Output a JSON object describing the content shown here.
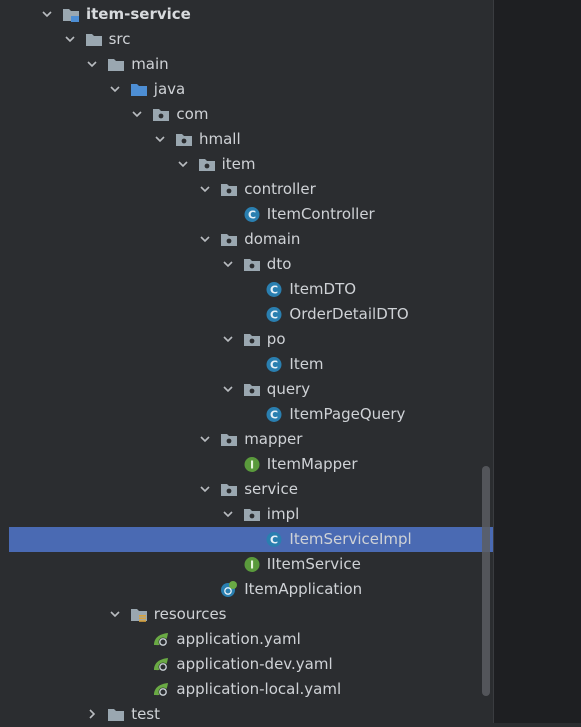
{
  "tree": {
    "nodes": [
      {
        "label": "item-service",
        "depth": 0,
        "icon": "module-folder-icon",
        "chevron": "down",
        "bold": true
      },
      {
        "label": "src",
        "depth": 1,
        "icon": "folder-icon",
        "chevron": "down"
      },
      {
        "label": "main",
        "depth": 2,
        "icon": "folder-icon",
        "chevron": "down"
      },
      {
        "label": "java",
        "depth": 3,
        "icon": "source-folder-icon",
        "chevron": "down"
      },
      {
        "label": "com",
        "depth": 4,
        "icon": "package-icon",
        "chevron": "down"
      },
      {
        "label": "hmall",
        "depth": 5,
        "icon": "package-icon",
        "chevron": "down"
      },
      {
        "label": "item",
        "depth": 6,
        "icon": "package-icon",
        "chevron": "down"
      },
      {
        "label": "controller",
        "depth": 7,
        "icon": "package-icon",
        "chevron": "down"
      },
      {
        "label": "ItemController",
        "depth": 8,
        "icon": "class-icon",
        "chevron": "none"
      },
      {
        "label": "domain",
        "depth": 7,
        "icon": "package-icon",
        "chevron": "down"
      },
      {
        "label": "dto",
        "depth": 8,
        "icon": "package-icon",
        "chevron": "down"
      },
      {
        "label": "ItemDTO",
        "depth": 9,
        "icon": "class-icon",
        "chevron": "none"
      },
      {
        "label": "OrderDetailDTO",
        "depth": 9,
        "icon": "class-icon",
        "chevron": "none"
      },
      {
        "label": "po",
        "depth": 8,
        "icon": "package-icon",
        "chevron": "down"
      },
      {
        "label": "Item",
        "depth": 9,
        "icon": "class-icon",
        "chevron": "none"
      },
      {
        "label": "query",
        "depth": 8,
        "icon": "package-icon",
        "chevron": "down"
      },
      {
        "label": "ItemPageQuery",
        "depth": 9,
        "icon": "class-icon",
        "chevron": "none"
      },
      {
        "label": "mapper",
        "depth": 7,
        "icon": "package-icon",
        "chevron": "down"
      },
      {
        "label": "ItemMapper",
        "depth": 8,
        "icon": "interface-icon",
        "chevron": "none"
      },
      {
        "label": "service",
        "depth": 7,
        "icon": "package-icon",
        "chevron": "down"
      },
      {
        "label": "impl",
        "depth": 8,
        "icon": "package-icon",
        "chevron": "down"
      },
      {
        "label": "ItemServiceImpl",
        "depth": 9,
        "icon": "class-icon",
        "chevron": "none",
        "selected": true
      },
      {
        "label": "IItemService",
        "depth": 8,
        "icon": "interface-icon",
        "chevron": "none"
      },
      {
        "label": "ItemApplication",
        "depth": 7,
        "icon": "spring-app-icon",
        "chevron": "none"
      },
      {
        "label": "resources",
        "depth": 3,
        "icon": "resources-folder-icon",
        "chevron": "down"
      },
      {
        "label": "application.yaml",
        "depth": 4,
        "icon": "spring-config-icon",
        "chevron": "none"
      },
      {
        "label": "application-dev.yaml",
        "depth": 4,
        "icon": "spring-config-icon",
        "chevron": "none"
      },
      {
        "label": "application-local.yaml",
        "depth": 4,
        "icon": "spring-config-icon",
        "chevron": "none"
      },
      {
        "label": "test",
        "depth": 2,
        "icon": "folder-icon",
        "chevron": "right"
      }
    ]
  },
  "colors": {
    "panel_bg": "#2b2d30",
    "editor_bg": "#1e1f22",
    "selection": "#4a6ab3",
    "text": "#cfd2d6",
    "folder": "#9aa7b0",
    "source_folder": "#4d8ed4",
    "class_badge": "#2a7fb0",
    "interface_badge": "#5a9a3c",
    "spring_green": "#6aaa44"
  }
}
